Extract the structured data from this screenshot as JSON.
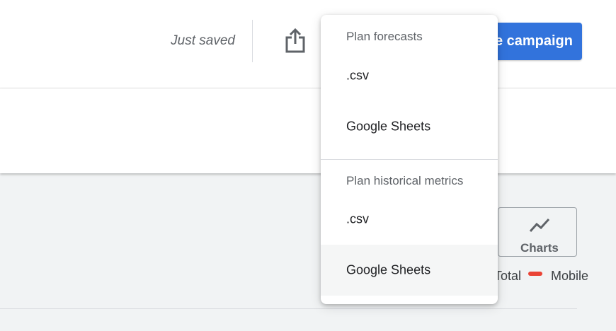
{
  "header": {
    "save_status": "Just saved",
    "share_icon": "share-export-icon",
    "campaign_button_label": "e campaign",
    "accent_color": "#3273dc"
  },
  "toolbar": {
    "charts_label": "Charts",
    "charts_icon": "trending-line-icon"
  },
  "legend": {
    "total_label": "Total",
    "mobile_label": "Mobile",
    "mobile_color": "#ea4335"
  },
  "download_menu": {
    "sections": [
      {
        "title": "Plan forecasts",
        "items": [
          {
            "label": ".csv"
          },
          {
            "label": "Google Sheets"
          }
        ]
      },
      {
        "title": "Plan historical metrics",
        "items": [
          {
            "label": ".csv"
          },
          {
            "label": "Google Sheets",
            "hovered": true
          }
        ]
      }
    ]
  }
}
